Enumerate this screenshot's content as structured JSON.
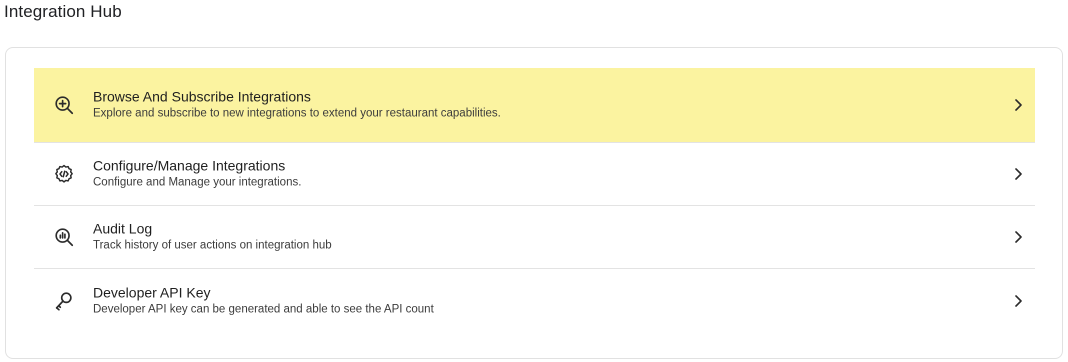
{
  "header": {
    "title": "Integration Hub"
  },
  "menu": {
    "items": [
      {
        "title": "Browse And Subscribe Integrations",
        "description": "Explore and subscribe to new integrations to extend your restaurant capabilities.",
        "icon": "zoom-in-icon",
        "highlighted": true
      },
      {
        "title": "Configure/Manage Integrations",
        "description": "Configure and Manage your integrations.",
        "icon": "gear-code-icon",
        "highlighted": false
      },
      {
        "title": "Audit Log",
        "description": "Track history of user actions on integration hub",
        "icon": "search-chart-icon",
        "highlighted": false
      },
      {
        "title": "Developer API Key",
        "description": "Developer API key can be generated and able to see the API count",
        "icon": "key-icon",
        "highlighted": false
      }
    ]
  },
  "colors": {
    "highlight": "#fbf3a0",
    "divider": "#e3e3e3",
    "text": "#1f1f1f"
  }
}
